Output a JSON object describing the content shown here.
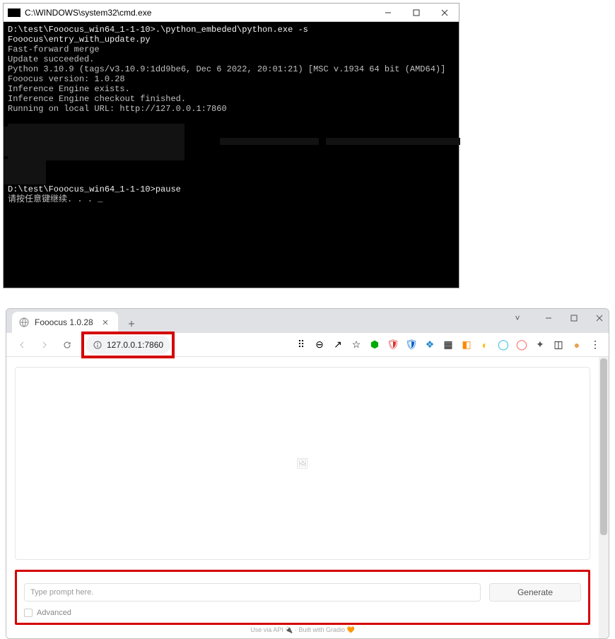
{
  "cmd": {
    "title": "C:\\WINDOWS\\system32\\cmd.exe",
    "lines": {
      "l0": "D:\\test\\Fooocus_win64_1-1-10>.\\python_embeded\\python.exe -s Fooocus\\entry_with_update.py",
      "l1": "Fast-forward merge",
      "l2": "Update succeeded.",
      "l3": "Python 3.10.9 (tags/v3.10.9:1dd9be6, Dec  6 2022, 20:01:21) [MSC v.1934 64 bit (AMD64)]",
      "l4": "Fooocus version: 1.0.28",
      "l5": "Inference Engine exists.",
      "l6": "Inference Engine checkout finished.",
      "l7": "Running on local URL:  http://127.0.0.1:7860",
      "l8": "",
      "p0": "D:\\test\\Fooocus_win64_1-1-10>pause",
      "p1": "请按任意键继续. . . "
    }
  },
  "browser": {
    "tab_title": "Fooocus 1.0.28",
    "url": "127.0.0.1:7860",
    "url_port_part": ":7860"
  },
  "page": {
    "prompt_placeholder": "Type prompt here.",
    "generate_label": "Generate",
    "advanced_label": "Advanced",
    "footer_left": "Use via API 🔌",
    "footer_right": " · Built with Gradio 🧡"
  }
}
